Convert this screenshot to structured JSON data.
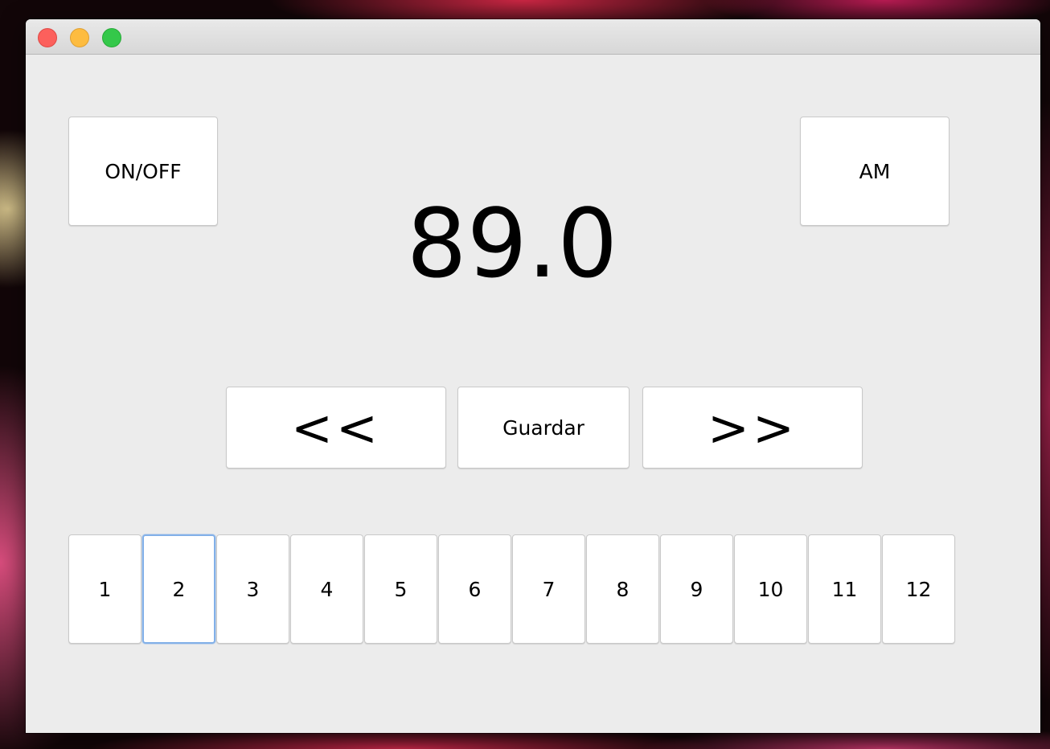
{
  "window": {
    "controls": [
      "close",
      "minimize",
      "zoom"
    ]
  },
  "radio": {
    "power_label": "ON/OFF",
    "band_label": "AM",
    "frequency": "89.0",
    "prev_label": "<<",
    "save_label": "Guardar",
    "next_label": ">>",
    "presets": [
      "1",
      "2",
      "3",
      "4",
      "5",
      "6",
      "7",
      "8",
      "9",
      "10",
      "11",
      "12"
    ],
    "focused_preset": "2"
  },
  "colors": {
    "window_bg": "#ececec",
    "button_bg": "#ffffff",
    "focus_ring": "#82b0e8",
    "close": "#fc605c",
    "minimize": "#fdbc40",
    "zoom": "#34c84a"
  }
}
